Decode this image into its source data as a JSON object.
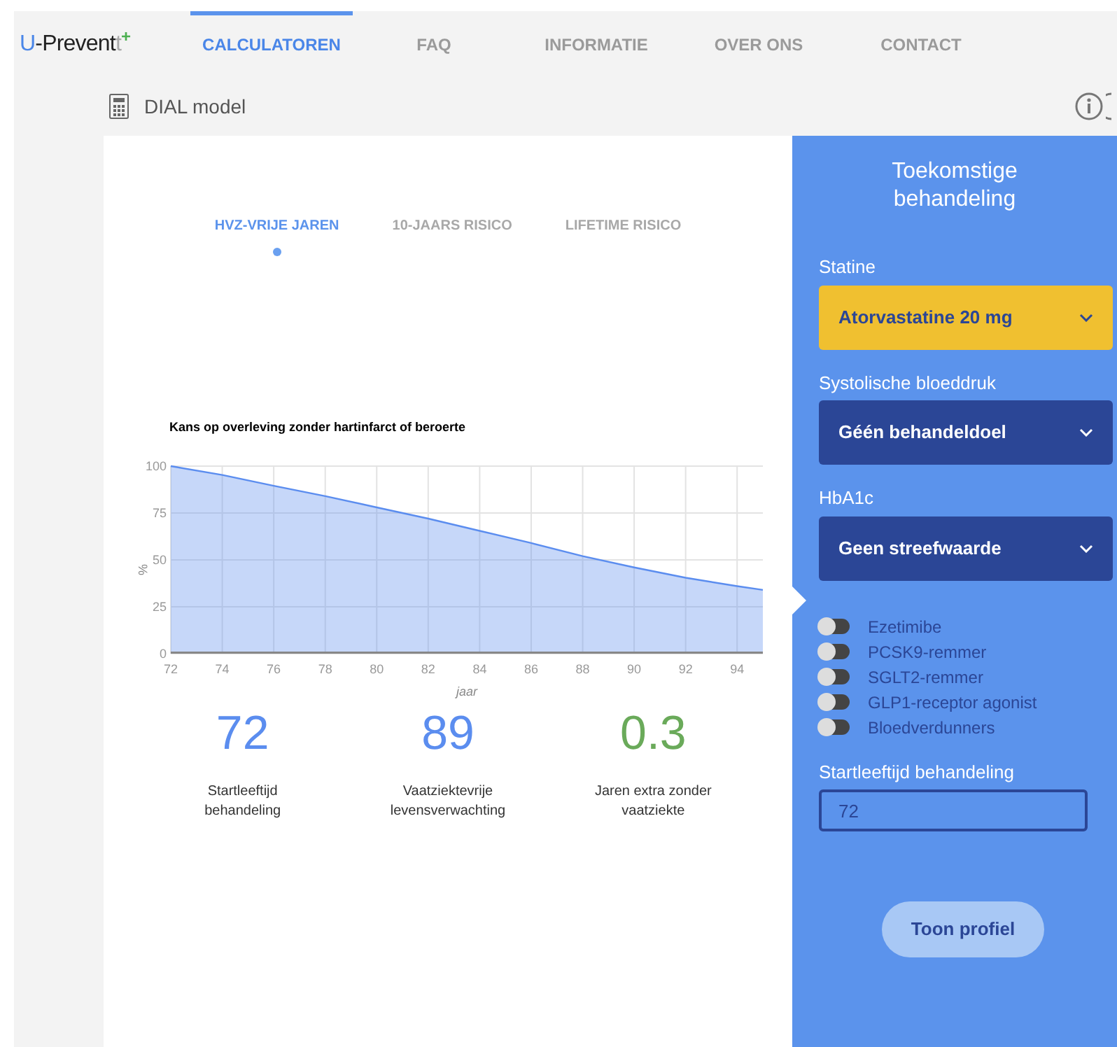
{
  "logo": {
    "text": "U-Prevent",
    "mark": "t",
    "plus": "+"
  },
  "nav": [
    {
      "label": "CALCULATOREN",
      "selected": true
    },
    {
      "label": "FAQ",
      "selected": false
    },
    {
      "label": "INFORMATIE",
      "selected": false
    },
    {
      "label": "OVER ONS",
      "selected": false
    },
    {
      "label": "CONTACT",
      "selected": false
    }
  ],
  "page_title": "DIAL model",
  "tabs": [
    {
      "label": "HVZ-VRIJE JAREN",
      "selected": true
    },
    {
      "label": "10-JAARS RISICO",
      "selected": false
    },
    {
      "label": "LIFETIME RISICO",
      "selected": false
    }
  ],
  "chart_data": {
    "type": "area",
    "title": "Kans op overleving zonder hartinfarct of beroerte",
    "xlabel": "jaar",
    "ylabel": "%",
    "x": [
      72,
      74,
      76,
      78,
      80,
      82,
      84,
      86,
      88,
      90,
      92,
      94,
      95
    ],
    "grid": true,
    "series": [
      {
        "color": "#5b8def",
        "values": [
          100,
          95.3,
          89.5,
          84,
          78,
          72,
          65.5,
          59,
          52,
          46,
          40.5,
          36,
          34
        ]
      }
    ],
    "xlim": [
      72,
      95
    ],
    "ylim": [
      0,
      100
    ],
    "xticks": [
      72,
      74,
      76,
      78,
      80,
      82,
      84,
      86,
      88,
      90,
      92,
      94
    ],
    "yticks": [
      0,
      25,
      50,
      75,
      100
    ]
  },
  "stats": [
    {
      "value": "72",
      "label": "Startleeftijd behandeling",
      "color": "#5b8def"
    },
    {
      "value": "89",
      "label": "Vaatziektevrije levensverwachting",
      "color": "#5b8def"
    },
    {
      "value": "0.3",
      "label": "Jaren extra zonder vaatziekte",
      "color": "#6aaa5a"
    }
  ],
  "panel": {
    "title": "Toekomstige behandeling",
    "selects": [
      {
        "label": "Statine",
        "value": "Atorvastatine 20 mg",
        "kind": "highlight"
      },
      {
        "label": "Systolische bloeddruk",
        "value": "Géén behandeldoel",
        "kind": "default"
      },
      {
        "label": "HbA1c",
        "value": "Geen streefwaarde",
        "kind": "default"
      }
    ],
    "toggles": [
      {
        "label": "Ezetimibe",
        "on": false
      },
      {
        "label": "PCSK9-remmer",
        "on": false
      },
      {
        "label": "SGLT2-remmer",
        "on": false
      },
      {
        "label": "GLP1-receptor agonist",
        "on": false
      },
      {
        "label": "Bloedverdunners",
        "on": false
      }
    ],
    "age": {
      "label": "Startleeftijd behandeling",
      "value": "72"
    },
    "button": "Toon profiel"
  }
}
